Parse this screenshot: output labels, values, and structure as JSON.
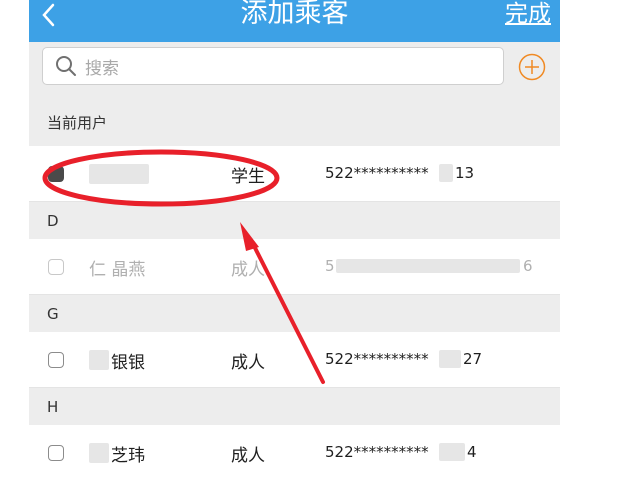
{
  "header": {
    "back_glyph": "‹",
    "title": "添加乘客",
    "done_label": "完成"
  },
  "search": {
    "placeholder": "搜索"
  },
  "sections": {
    "current_user": "当前用户",
    "d": "D",
    "g": "G",
    "h": "H"
  },
  "passengers": {
    "current": {
      "name": "",
      "type": "学生",
      "id_prefix": "522**********",
      "id_suffix": "13",
      "checked": true
    },
    "d1": {
      "name_visible": "仁  晶燕",
      "type": "成人",
      "id_prefix": "5",
      "id_suffix": "6",
      "faded": true
    },
    "g1": {
      "name_visible": "银银",
      "type": "成人",
      "id_prefix": "522**********",
      "id_suffix": "27"
    },
    "h1": {
      "name_visible": "芝玮",
      "type": "成人",
      "id_prefix": "522**********",
      "id_suffix": "4"
    }
  },
  "icons": {
    "back": "chevron-left-icon",
    "search": "search-icon",
    "add": "plus-circle-icon",
    "annotation": "red-circle-arrow-annotation"
  },
  "colors": {
    "nav_bar": "#3da1e6",
    "accent_add": "#f08a24",
    "annotation_red": "#e8202a",
    "section_bg": "#ededed"
  }
}
